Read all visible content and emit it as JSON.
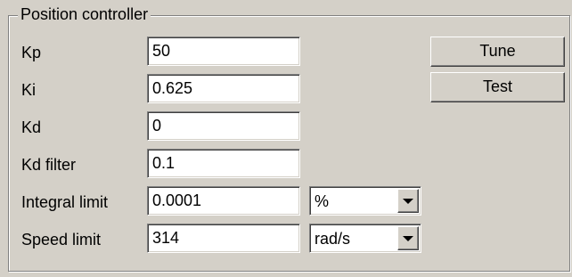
{
  "group": {
    "title": "Position controller"
  },
  "fields": [
    {
      "label": "Kp",
      "value": "50"
    },
    {
      "label": "Ki",
      "value": "0.625"
    },
    {
      "label": "Kd",
      "value": "0"
    },
    {
      "label": "Kd filter",
      "value": "0.1"
    },
    {
      "label": "Integral limit",
      "value": "0.0001",
      "unit": "%"
    },
    {
      "label": "Speed limit",
      "value": "314",
      "unit": "rad/s"
    }
  ],
  "buttons": {
    "tune": "Tune",
    "test": "Test"
  },
  "icons": {
    "dropdown": "chevron-down-icon"
  }
}
